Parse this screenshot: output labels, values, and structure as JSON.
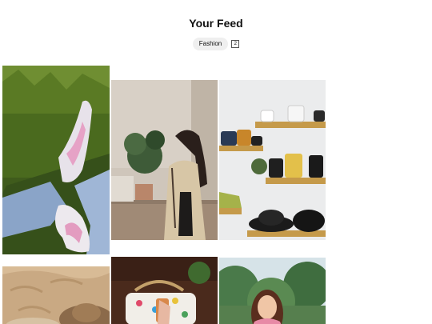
{
  "feed": {
    "title": "Your Feed"
  },
  "filters": {
    "active_chip": "Fashion",
    "count": "2"
  },
  "pins": [
    {
      "subject": "pink-sneakers-on-grass"
    },
    {
      "subject": "woman-in-trench-coat"
    },
    {
      "subject": "handbag-store-shelves"
    },
    {
      "subject": "sun-hat-on-sand"
    },
    {
      "subject": "printed-handbag-with-phone"
    },
    {
      "subject": "woman-outdoors-smiling"
    }
  ],
  "colors": {
    "background": "#ffffff",
    "chip_bg": "#efefef",
    "text": "#111111"
  }
}
